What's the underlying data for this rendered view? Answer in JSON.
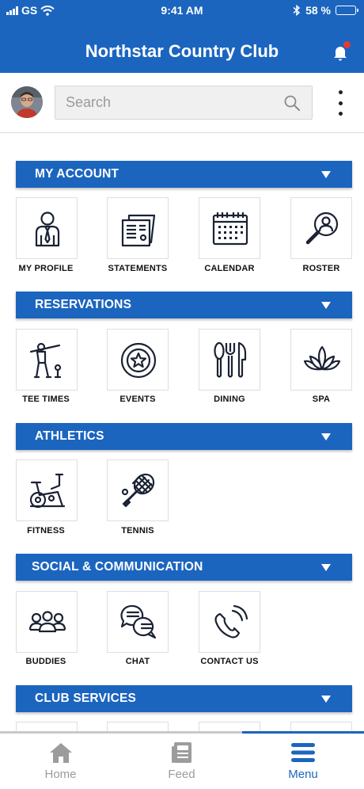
{
  "status": {
    "carrier": "GS",
    "time": "9:41 AM",
    "battery": "58 %",
    "battery_level": 0.58
  },
  "header": {
    "title": "Northstar Country Club"
  },
  "search": {
    "placeholder": "Search"
  },
  "sections": [
    {
      "label": "MY ACCOUNT",
      "items": [
        {
          "label": "MY PROFILE",
          "icon": "person-tie-icon"
        },
        {
          "label": "STATEMENTS",
          "icon": "statement-icon"
        },
        {
          "label": "CALENDAR",
          "icon": "calendar-icon"
        },
        {
          "label": "ROSTER",
          "icon": "roster-search-icon"
        }
      ]
    },
    {
      "label": "RESERVATIONS",
      "items": [
        {
          "label": "TEE TIMES",
          "icon": "golfer-icon"
        },
        {
          "label": "EVENTS",
          "icon": "star-badge-icon"
        },
        {
          "label": "DINING",
          "icon": "cutlery-icon"
        },
        {
          "label": "SPA",
          "icon": "lotus-icon"
        }
      ]
    },
    {
      "label": "ATHLETICS",
      "items": [
        {
          "label": "FITNESS",
          "icon": "exercise-bike-icon"
        },
        {
          "label": "TENNIS",
          "icon": "tennis-racket-icon"
        }
      ]
    },
    {
      "label": "SOCIAL & COMMUNICATION",
      "items": [
        {
          "label": "BUDDIES",
          "icon": "group-icon"
        },
        {
          "label": "CHAT",
          "icon": "chat-bubbles-icon"
        },
        {
          "label": "CONTACT US",
          "icon": "phone-icon"
        }
      ]
    },
    {
      "label": "CLUB SERVICES",
      "items": []
    }
  ],
  "tabs": [
    {
      "label": "Home",
      "icon": "home-icon",
      "active": false
    },
    {
      "label": "Feed",
      "icon": "feed-icon",
      "active": false
    },
    {
      "label": "Menu",
      "icon": "menu-icon",
      "active": true
    }
  ],
  "colors": {
    "brand": "#1b65bf",
    "notification": "#e53935",
    "tab_inactive": "#9c9c9c"
  }
}
